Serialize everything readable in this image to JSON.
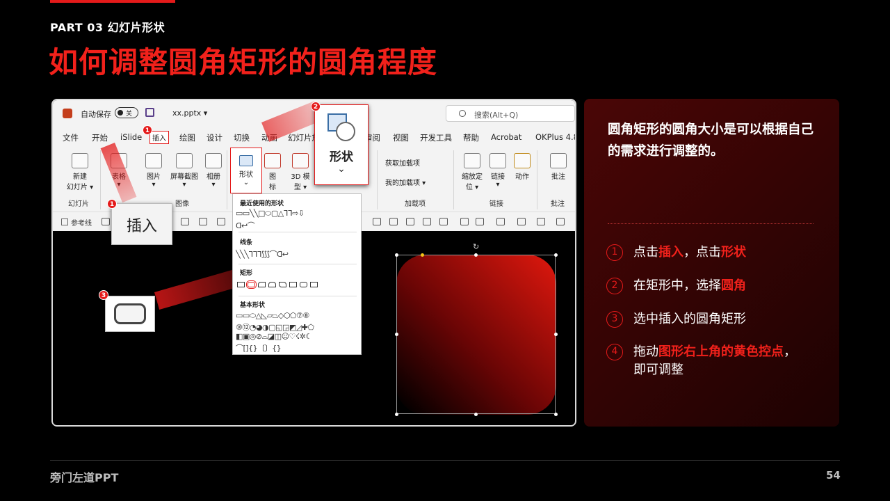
{
  "header": {
    "part": "PART 03  幻灯片形状",
    "title": "如何调整圆角矩形的圆角程度"
  },
  "app": {
    "autosave": "自动保存",
    "toggle": "关",
    "filename": "xx.pptx ▾",
    "search_placeholder": "搜索(Alt+Q)",
    "menu": [
      "文件",
      "开始",
      "iSlide",
      "插入",
      "绘图",
      "设计",
      "切换",
      "动画",
      "幻灯片放映",
      "审阅",
      "视图",
      "开发工具",
      "帮助",
      "Acrobat",
      "OKPlus 4.8"
    ],
    "tools": {
      "new_slide": "新建\n幻灯片 ▾",
      "table": "表格\n▾",
      "picture": "图片\n▾",
      "screenshot": "屏幕截图\n▾",
      "album": "相册\n▾",
      "shapes": "形状\n⌄",
      "icons": "图\n标",
      "model3d": "3D 模\n型 ▾",
      "get_addins": "获取加载项",
      "my_addins": "我的加载项 ▾",
      "zoom": "缩放定\n位 ▾",
      "link": "链接\n▾",
      "action": "动作",
      "comment": "批注"
    },
    "groups": {
      "slides": "幻灯片",
      "images": "图像",
      "addins": "加载项",
      "links": "链接",
      "comments": "批注"
    },
    "gridlines": "参考线"
  },
  "gallery": {
    "recent": "最近使用的形状",
    "recent_row1": "▭▭╲╲□⬭▢△ᒣᒣ⇨⇩",
    "recent_row2": "ᗡ↩⌒",
    "lines": "线条",
    "lines_row": "╲╲╲ᒣᒣᒣ⟆⟆⟆⌒ᗡ↩",
    "rects": "矩形",
    "basic": "基本形状",
    "basic_row1": "▭▭⬭△◺▱⏢◇⬡⬠⑦⑧",
    "basic_row2": "⑩⑫◔◕◑▢◱◲◩◿✚⬠",
    "basic_row3": "◧▣◎⊘⌓◪◫☺♡☇✲☾",
    "basic_row4": "⌒[]{}〔〕{}"
  },
  "callouts": {
    "insert_zoom": "插入",
    "shapes_zoom": "形状",
    "shapes_caret": "⌄",
    "badge1": "1",
    "badge2": "2",
    "badge3": "3"
  },
  "panel": {
    "intro": "圆角矩形的圆角大小是可以根据自己的需求进行调整的。",
    "steps": [
      {
        "num": "1",
        "a": "点击",
        "b": "插入",
        "c": "，点击",
        "d": "形状",
        "e": ""
      },
      {
        "num": "2",
        "a": "在矩形中，选择",
        "b": "圆角",
        "c": "",
        "d": "",
        "e": ""
      },
      {
        "num": "3",
        "a": "选中插入的圆角矩形",
        "b": "",
        "c": "",
        "d": "",
        "e": ""
      },
      {
        "num": "4",
        "a": "拖动",
        "b": "图形右上角的黄色控点",
        "c": "，",
        "d": "",
        "e": "即可调整"
      }
    ]
  },
  "footer": {
    "brand": "旁门左道PPT",
    "page": "54"
  },
  "colors": {
    "accent": "#e41a1a",
    "title": "#f1211b",
    "handle": "#f5c518"
  }
}
